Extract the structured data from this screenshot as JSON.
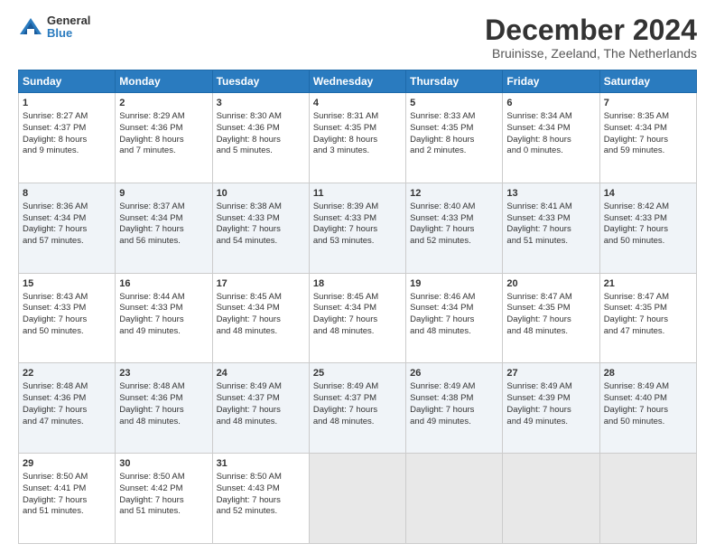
{
  "logo": {
    "general": "General",
    "blue": "Blue"
  },
  "title": "December 2024",
  "subtitle": "Bruinisse, Zeeland, The Netherlands",
  "days_of_week": [
    "Sunday",
    "Monday",
    "Tuesday",
    "Wednesday",
    "Thursday",
    "Friday",
    "Saturday"
  ],
  "weeks": [
    [
      {
        "day": 1,
        "lines": [
          "Sunrise: 8:27 AM",
          "Sunset: 4:37 PM",
          "Daylight: 8 hours",
          "and 9 minutes."
        ]
      },
      {
        "day": 2,
        "lines": [
          "Sunrise: 8:29 AM",
          "Sunset: 4:36 PM",
          "Daylight: 8 hours",
          "and 7 minutes."
        ]
      },
      {
        "day": 3,
        "lines": [
          "Sunrise: 8:30 AM",
          "Sunset: 4:36 PM",
          "Daylight: 8 hours",
          "and 5 minutes."
        ]
      },
      {
        "day": 4,
        "lines": [
          "Sunrise: 8:31 AM",
          "Sunset: 4:35 PM",
          "Daylight: 8 hours",
          "and 3 minutes."
        ]
      },
      {
        "day": 5,
        "lines": [
          "Sunrise: 8:33 AM",
          "Sunset: 4:35 PM",
          "Daylight: 8 hours",
          "and 2 minutes."
        ]
      },
      {
        "day": 6,
        "lines": [
          "Sunrise: 8:34 AM",
          "Sunset: 4:34 PM",
          "Daylight: 8 hours",
          "and 0 minutes."
        ]
      },
      {
        "day": 7,
        "lines": [
          "Sunrise: 8:35 AM",
          "Sunset: 4:34 PM",
          "Daylight: 7 hours",
          "and 59 minutes."
        ]
      }
    ],
    [
      {
        "day": 8,
        "lines": [
          "Sunrise: 8:36 AM",
          "Sunset: 4:34 PM",
          "Daylight: 7 hours",
          "and 57 minutes."
        ]
      },
      {
        "day": 9,
        "lines": [
          "Sunrise: 8:37 AM",
          "Sunset: 4:34 PM",
          "Daylight: 7 hours",
          "and 56 minutes."
        ]
      },
      {
        "day": 10,
        "lines": [
          "Sunrise: 8:38 AM",
          "Sunset: 4:33 PM",
          "Daylight: 7 hours",
          "and 54 minutes."
        ]
      },
      {
        "day": 11,
        "lines": [
          "Sunrise: 8:39 AM",
          "Sunset: 4:33 PM",
          "Daylight: 7 hours",
          "and 53 minutes."
        ]
      },
      {
        "day": 12,
        "lines": [
          "Sunrise: 8:40 AM",
          "Sunset: 4:33 PM",
          "Daylight: 7 hours",
          "and 52 minutes."
        ]
      },
      {
        "day": 13,
        "lines": [
          "Sunrise: 8:41 AM",
          "Sunset: 4:33 PM",
          "Daylight: 7 hours",
          "and 51 minutes."
        ]
      },
      {
        "day": 14,
        "lines": [
          "Sunrise: 8:42 AM",
          "Sunset: 4:33 PM",
          "Daylight: 7 hours",
          "and 50 minutes."
        ]
      }
    ],
    [
      {
        "day": 15,
        "lines": [
          "Sunrise: 8:43 AM",
          "Sunset: 4:33 PM",
          "Daylight: 7 hours",
          "and 50 minutes."
        ]
      },
      {
        "day": 16,
        "lines": [
          "Sunrise: 8:44 AM",
          "Sunset: 4:33 PM",
          "Daylight: 7 hours",
          "and 49 minutes."
        ]
      },
      {
        "day": 17,
        "lines": [
          "Sunrise: 8:45 AM",
          "Sunset: 4:34 PM",
          "Daylight: 7 hours",
          "and 48 minutes."
        ]
      },
      {
        "day": 18,
        "lines": [
          "Sunrise: 8:45 AM",
          "Sunset: 4:34 PM",
          "Daylight: 7 hours",
          "and 48 minutes."
        ]
      },
      {
        "day": 19,
        "lines": [
          "Sunrise: 8:46 AM",
          "Sunset: 4:34 PM",
          "Daylight: 7 hours",
          "and 48 minutes."
        ]
      },
      {
        "day": 20,
        "lines": [
          "Sunrise: 8:47 AM",
          "Sunset: 4:35 PM",
          "Daylight: 7 hours",
          "and 48 minutes."
        ]
      },
      {
        "day": 21,
        "lines": [
          "Sunrise: 8:47 AM",
          "Sunset: 4:35 PM",
          "Daylight: 7 hours",
          "and 47 minutes."
        ]
      }
    ],
    [
      {
        "day": 22,
        "lines": [
          "Sunrise: 8:48 AM",
          "Sunset: 4:36 PM",
          "Daylight: 7 hours",
          "and 47 minutes."
        ]
      },
      {
        "day": 23,
        "lines": [
          "Sunrise: 8:48 AM",
          "Sunset: 4:36 PM",
          "Daylight: 7 hours",
          "and 48 minutes."
        ]
      },
      {
        "day": 24,
        "lines": [
          "Sunrise: 8:49 AM",
          "Sunset: 4:37 PM",
          "Daylight: 7 hours",
          "and 48 minutes."
        ]
      },
      {
        "day": 25,
        "lines": [
          "Sunrise: 8:49 AM",
          "Sunset: 4:37 PM",
          "Daylight: 7 hours",
          "and 48 minutes."
        ]
      },
      {
        "day": 26,
        "lines": [
          "Sunrise: 8:49 AM",
          "Sunset: 4:38 PM",
          "Daylight: 7 hours",
          "and 49 minutes."
        ]
      },
      {
        "day": 27,
        "lines": [
          "Sunrise: 8:49 AM",
          "Sunset: 4:39 PM",
          "Daylight: 7 hours",
          "and 49 minutes."
        ]
      },
      {
        "day": 28,
        "lines": [
          "Sunrise: 8:49 AM",
          "Sunset: 4:40 PM",
          "Daylight: 7 hours",
          "and 50 minutes."
        ]
      }
    ],
    [
      {
        "day": 29,
        "lines": [
          "Sunrise: 8:50 AM",
          "Sunset: 4:41 PM",
          "Daylight: 7 hours",
          "and 51 minutes."
        ]
      },
      {
        "day": 30,
        "lines": [
          "Sunrise: 8:50 AM",
          "Sunset: 4:42 PM",
          "Daylight: 7 hours",
          "and 51 minutes."
        ]
      },
      {
        "day": 31,
        "lines": [
          "Sunrise: 8:50 AM",
          "Sunset: 4:43 PM",
          "Daylight: 7 hours",
          "and 52 minutes."
        ]
      },
      null,
      null,
      null,
      null
    ]
  ]
}
